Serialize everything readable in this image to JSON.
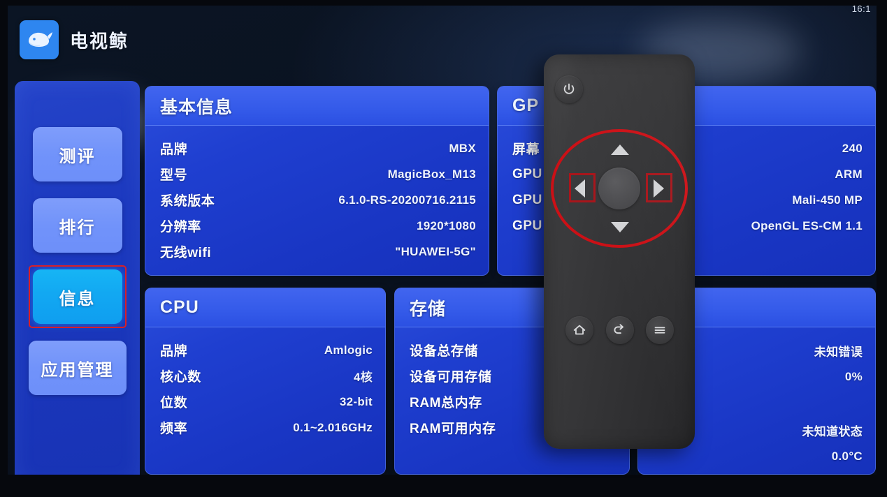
{
  "status": {
    "clock": "16:1"
  },
  "header": {
    "title": "电视鲸",
    "logo_icon": "whale-icon"
  },
  "sidebar": {
    "items": [
      {
        "label": "测评",
        "selected": false
      },
      {
        "label": "排行",
        "selected": false
      },
      {
        "label": "信息",
        "selected": true
      },
      {
        "label": "应用管理",
        "selected": false
      }
    ]
  },
  "cards": [
    {
      "id": "basic-info",
      "title": "基本信息",
      "rows": [
        {
          "key": "品牌",
          "value": "MBX"
        },
        {
          "key": "型号",
          "value": "MagicBox_M13"
        },
        {
          "key": "系统版本",
          "value": "6.1.0-RS-20200716.2115"
        },
        {
          "key": "分辨率",
          "value": "1920*1080"
        },
        {
          "key": "无线wifi",
          "value": "\"HUAWEI-5G\""
        }
      ]
    },
    {
      "id": "gpu-info",
      "title": "GP",
      "rows": [
        {
          "key": "屏幕",
          "value": "240"
        },
        {
          "key": "GPU",
          "value": "ARM"
        },
        {
          "key": "GPU",
          "value": "Mali-450 MP"
        },
        {
          "key": "GPU",
          "value": "OpenGL ES-CM 1.1"
        }
      ]
    },
    {
      "id": "cpu-info",
      "title": "CPU",
      "rows": [
        {
          "key": "品牌",
          "value": "Amlogic"
        },
        {
          "key": "核心数",
          "value": "4核"
        },
        {
          "key": "位数",
          "value": "32-bit"
        },
        {
          "key": "频率",
          "value": "0.1~2.016GHz"
        }
      ]
    },
    {
      "id": "storage-info",
      "title": "存储",
      "rows": [
        {
          "key": "设备总存储",
          "value": ""
        },
        {
          "key": "设备可用存储",
          "value": ""
        },
        {
          "key": "RAM总内存",
          "value": ""
        },
        {
          "key": "RAM可用内存",
          "value": ""
        }
      ]
    },
    {
      "id": "sensor-info",
      "title": "",
      "rows": [
        {
          "key": "",
          "value": "未知错误"
        },
        {
          "key": "",
          "value": "0%"
        },
        {
          "key": "",
          "value": ""
        },
        {
          "key": "",
          "value": "未知道状态"
        },
        {
          "key": "",
          "value": "0.0°C"
        }
      ]
    }
  ],
  "remote": {
    "power_icon": "power-icon",
    "dpad": {
      "up_icon": "arrow-up-icon",
      "down_icon": "arrow-down-icon",
      "left_icon": "arrow-left-icon",
      "right_icon": "arrow-right-icon",
      "center_icon": "ok-button"
    },
    "buttons": [
      {
        "icon": "home-icon"
      },
      {
        "icon": "back-icon"
      },
      {
        "icon": "menu-icon"
      }
    ],
    "annotation_color": "#cc1016"
  },
  "colors": {
    "accent_blue": "#2e86f0",
    "card_blue": "#1f3fd0",
    "card_header_blue": "#345ae9",
    "sidebar_blue": "#1c39bf",
    "selected_cyan": "#12a8f2",
    "annotation_red": "#cc1016"
  }
}
